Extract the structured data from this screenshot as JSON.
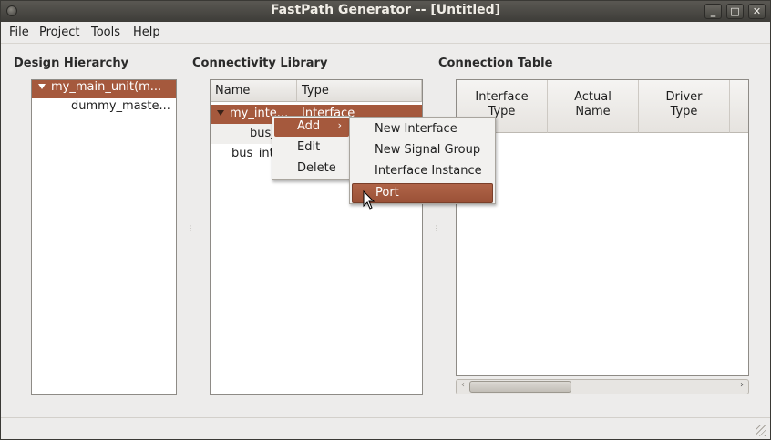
{
  "window": {
    "title": "FastPath Generator -- [Untitled]"
  },
  "menubar": {
    "items": [
      "File",
      "Project",
      "Tools",
      "Help"
    ]
  },
  "hierarchy": {
    "label": "Design Hierarchy",
    "items": [
      {
        "text": "my_main_unit(m...",
        "selected": true
      },
      {
        "text": "dummy_maste...",
        "selected": false
      }
    ]
  },
  "library": {
    "label": "Connectivity Library",
    "columns": [
      "Name",
      "Type"
    ],
    "rows": [
      {
        "name": "my_inte...",
        "type": "Interface"
      },
      {
        "name": "bus_"
      },
      {
        "name": "bus_int"
      }
    ]
  },
  "context_menu": {
    "items": [
      "Add",
      "Edit",
      "Delete"
    ]
  },
  "submenu": {
    "items": [
      "New Interface",
      "New Signal Group",
      "Interface Instance",
      "Port"
    ]
  },
  "connection_table": {
    "label": "Connection Table",
    "columns": [
      {
        "line1": "Interface",
        "line2": "Type"
      },
      {
        "line1": "Actual",
        "line2": "Name"
      },
      {
        "line1": "Driver",
        "line2": "Type"
      }
    ]
  },
  "colors": {
    "selection": "#a5593d",
    "titlebar": "#3d3c38"
  }
}
